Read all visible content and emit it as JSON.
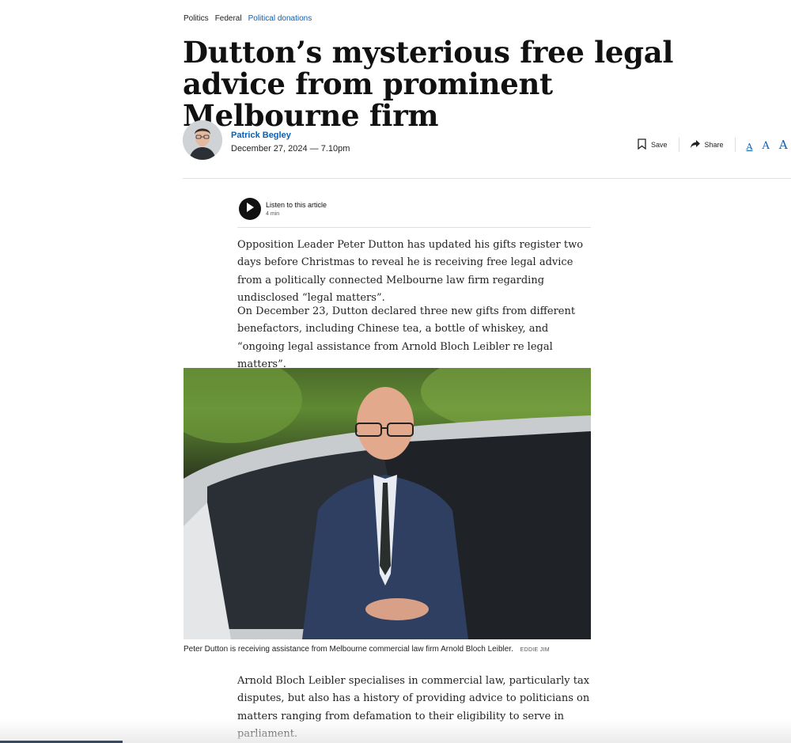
{
  "breadcrumb": [
    "Politics",
    "Federal",
    "Political donations"
  ],
  "headline": "Dutton’s mysterious free legal advice from prominent Melbourne firm",
  "author": {
    "name": "Patrick Begley",
    "date": "December 27, 2024 — 7.10pm"
  },
  "tools": {
    "save_label": "Save",
    "share_label": "Share",
    "font_sizes": [
      "A",
      "A",
      "A"
    ]
  },
  "audio": {
    "label": "Listen to this article",
    "duration": "4 min"
  },
  "paragraphs": [
    "Opposition Leader Peter Dutton has updated his gifts register two days before Christmas to reveal he is receiving free legal advice from a politically connected Melbourne law firm regarding undisclosed “legal matters”.",
    "On December 23, Dutton declared three new gifts from different benefactors, including Chinese tea, a bottle of whiskey, and “ongoing legal assistance from Arnold Bloch Leibler re legal matters”.",
    "Arnold Bloch Leibler specialises in commercial law, particularly tax disputes, but also has a history of providing advice to politicians on matters ranging from defamation to their eligibility to serve in parliament."
  ],
  "photo": {
    "caption": "Peter Dutton is receiving assistance from Melbourne commercial law firm Arnold Bloch Leibler.",
    "credit": "EDDIE JIM"
  },
  "colors": {
    "link": "#0a5fb4",
    "text": "#222222"
  }
}
